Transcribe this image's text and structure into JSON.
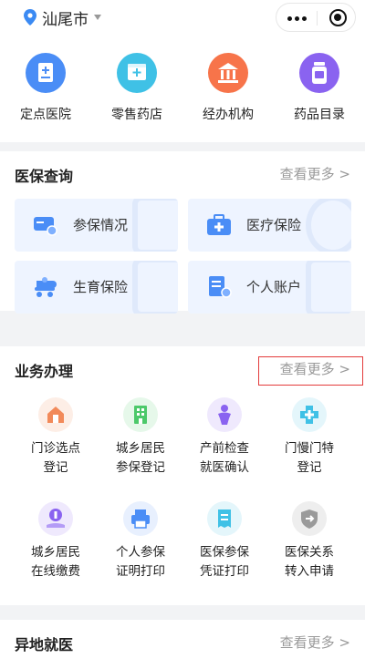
{
  "topbar": {
    "city": "汕尾市",
    "icons": [
      "location-pin-icon",
      "caret-down-icon",
      "more-dots-icon",
      "close-target-icon"
    ]
  },
  "quick_nav": [
    {
      "label": "定点医院",
      "icon": "hospital-doc-icon",
      "color": "#4a8df6"
    },
    {
      "label": "零售药店",
      "icon": "pharmacy-icon",
      "color": "#3fc1e6"
    },
    {
      "label": "经办机构",
      "icon": "institution-icon",
      "color": "#f7744a"
    },
    {
      "label": "药品目录",
      "icon": "medicine-bottle-icon",
      "color": "#8a63f0"
    }
  ],
  "insurance_query": {
    "title": "医保查询",
    "more": "查看更多 >",
    "tiles": [
      {
        "label": "参保情况",
        "icon": "insured-card-icon"
      },
      {
        "label": "医疗保险",
        "icon": "medical-kit-icon"
      },
      {
        "label": "生育保险",
        "icon": "stroller-icon"
      },
      {
        "label": "个人账户",
        "icon": "account-doc-icon"
      }
    ]
  },
  "business": {
    "title": "业务办理",
    "more": "查看更多 >",
    "items": [
      {
        "line1": "门诊选点",
        "line2": "登记",
        "icon": "clinic-house-icon",
        "color": "#f28a5a",
        "bg": "#fdeee6"
      },
      {
        "line1": "城乡居民",
        "line2": "参保登记",
        "icon": "building-icon",
        "color": "#4cc96a",
        "bg": "#e6f8ea"
      },
      {
        "line1": "产前检查",
        "line2": "就医确认",
        "icon": "prenatal-person-icon",
        "color": "#8a63f0",
        "bg": "#efe9fd"
      },
      {
        "line1": "门慢门特",
        "line2": "登记",
        "icon": "medical-cross-icon",
        "color": "#3fc1e6",
        "bg": "#e4f6fb"
      },
      {
        "line1": "城乡居民",
        "line2": "在线缴费",
        "icon": "payment-hand-icon",
        "color": "#8a63f0",
        "bg": "#efe9fd"
      },
      {
        "line1": "个人参保",
        "line2": "证明打印",
        "icon": "printer-icon",
        "color": "#4a8df6",
        "bg": "#e8f0fe"
      },
      {
        "line1": "医保参保",
        "line2": "凭证打印",
        "icon": "receipt-icon",
        "color": "#3fc1e6",
        "bg": "#e4f6fb"
      },
      {
        "line1": "医保关系",
        "line2": "转入申请",
        "icon": "shield-transfer-icon",
        "color": "#9a9a9a",
        "bg": "#eeeeee"
      }
    ]
  },
  "remote_medical": {
    "title": "异地就医",
    "more": "查看更多 >"
  }
}
